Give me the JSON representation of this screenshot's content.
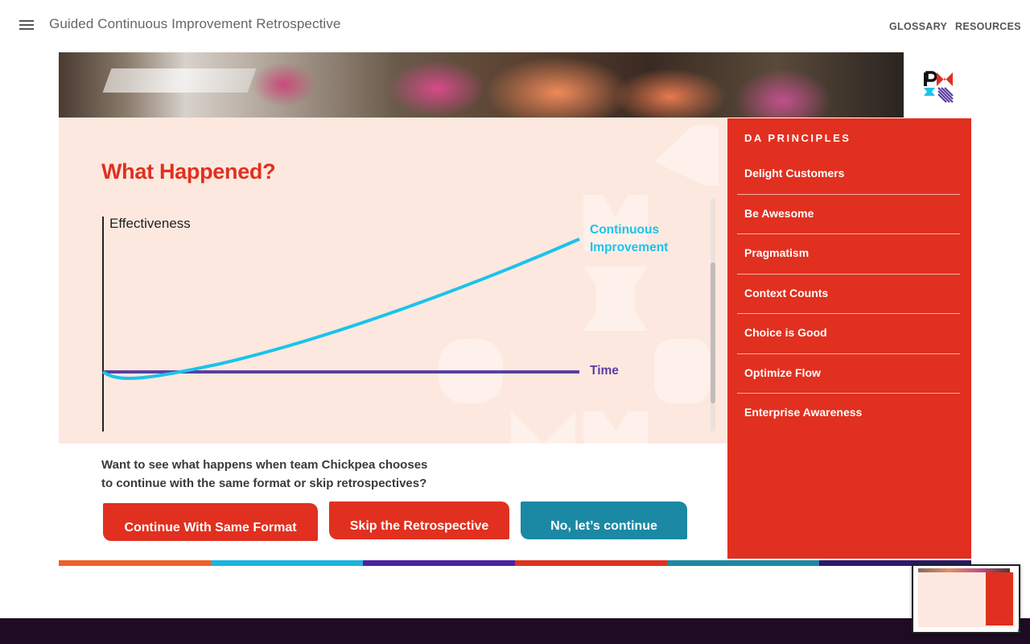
{
  "header": {
    "app_title": "Guided Continuous Improvement Retrospective",
    "nav": [
      {
        "label": "GLOSSARY"
      },
      {
        "label": "RESOURCES"
      }
    ]
  },
  "content": {
    "title": "What Happened?",
    "question_line1": "Want to see what happens when team Chickpea chooses",
    "question_line2": "to continue with the same format or skip retrospectives?"
  },
  "chart_data": {
    "type": "line",
    "ylabel": "Effectiveness",
    "series": [
      {
        "name": "Continuous Improvement",
        "color": "#1bc3ea"
      },
      {
        "name": "Time",
        "color": "#5b3fa0"
      }
    ],
    "labels": {
      "ci_line1": "Continuous",
      "ci_line2": "Improvement",
      "time": "Time"
    }
  },
  "buttons": {
    "continue_same": "Continue With Same Format",
    "skip": "Skip the Retrospective",
    "no_continue": "No, let’s continue"
  },
  "sidebar": {
    "heading": "DA PRINCIPLES",
    "items": [
      {
        "label": "Delight Customers"
      },
      {
        "label": "Be Awesome"
      },
      {
        "label": "Pragmatism"
      },
      {
        "label": "Context Counts"
      },
      {
        "label": "Choice is Good"
      },
      {
        "label": "Optimize Flow"
      },
      {
        "label": "Enterprise Awareness"
      }
    ]
  },
  "colors": {
    "accent_red": "#e1301f",
    "teal": "#1b88a4",
    "cyan": "#1bc3ea",
    "purple": "#5b3fa0",
    "panel_bg": "#fde8df",
    "footer_bg": "#1d0c24"
  },
  "icons": {
    "menu": "hamburger-icon",
    "logo": "pmi-logo"
  }
}
